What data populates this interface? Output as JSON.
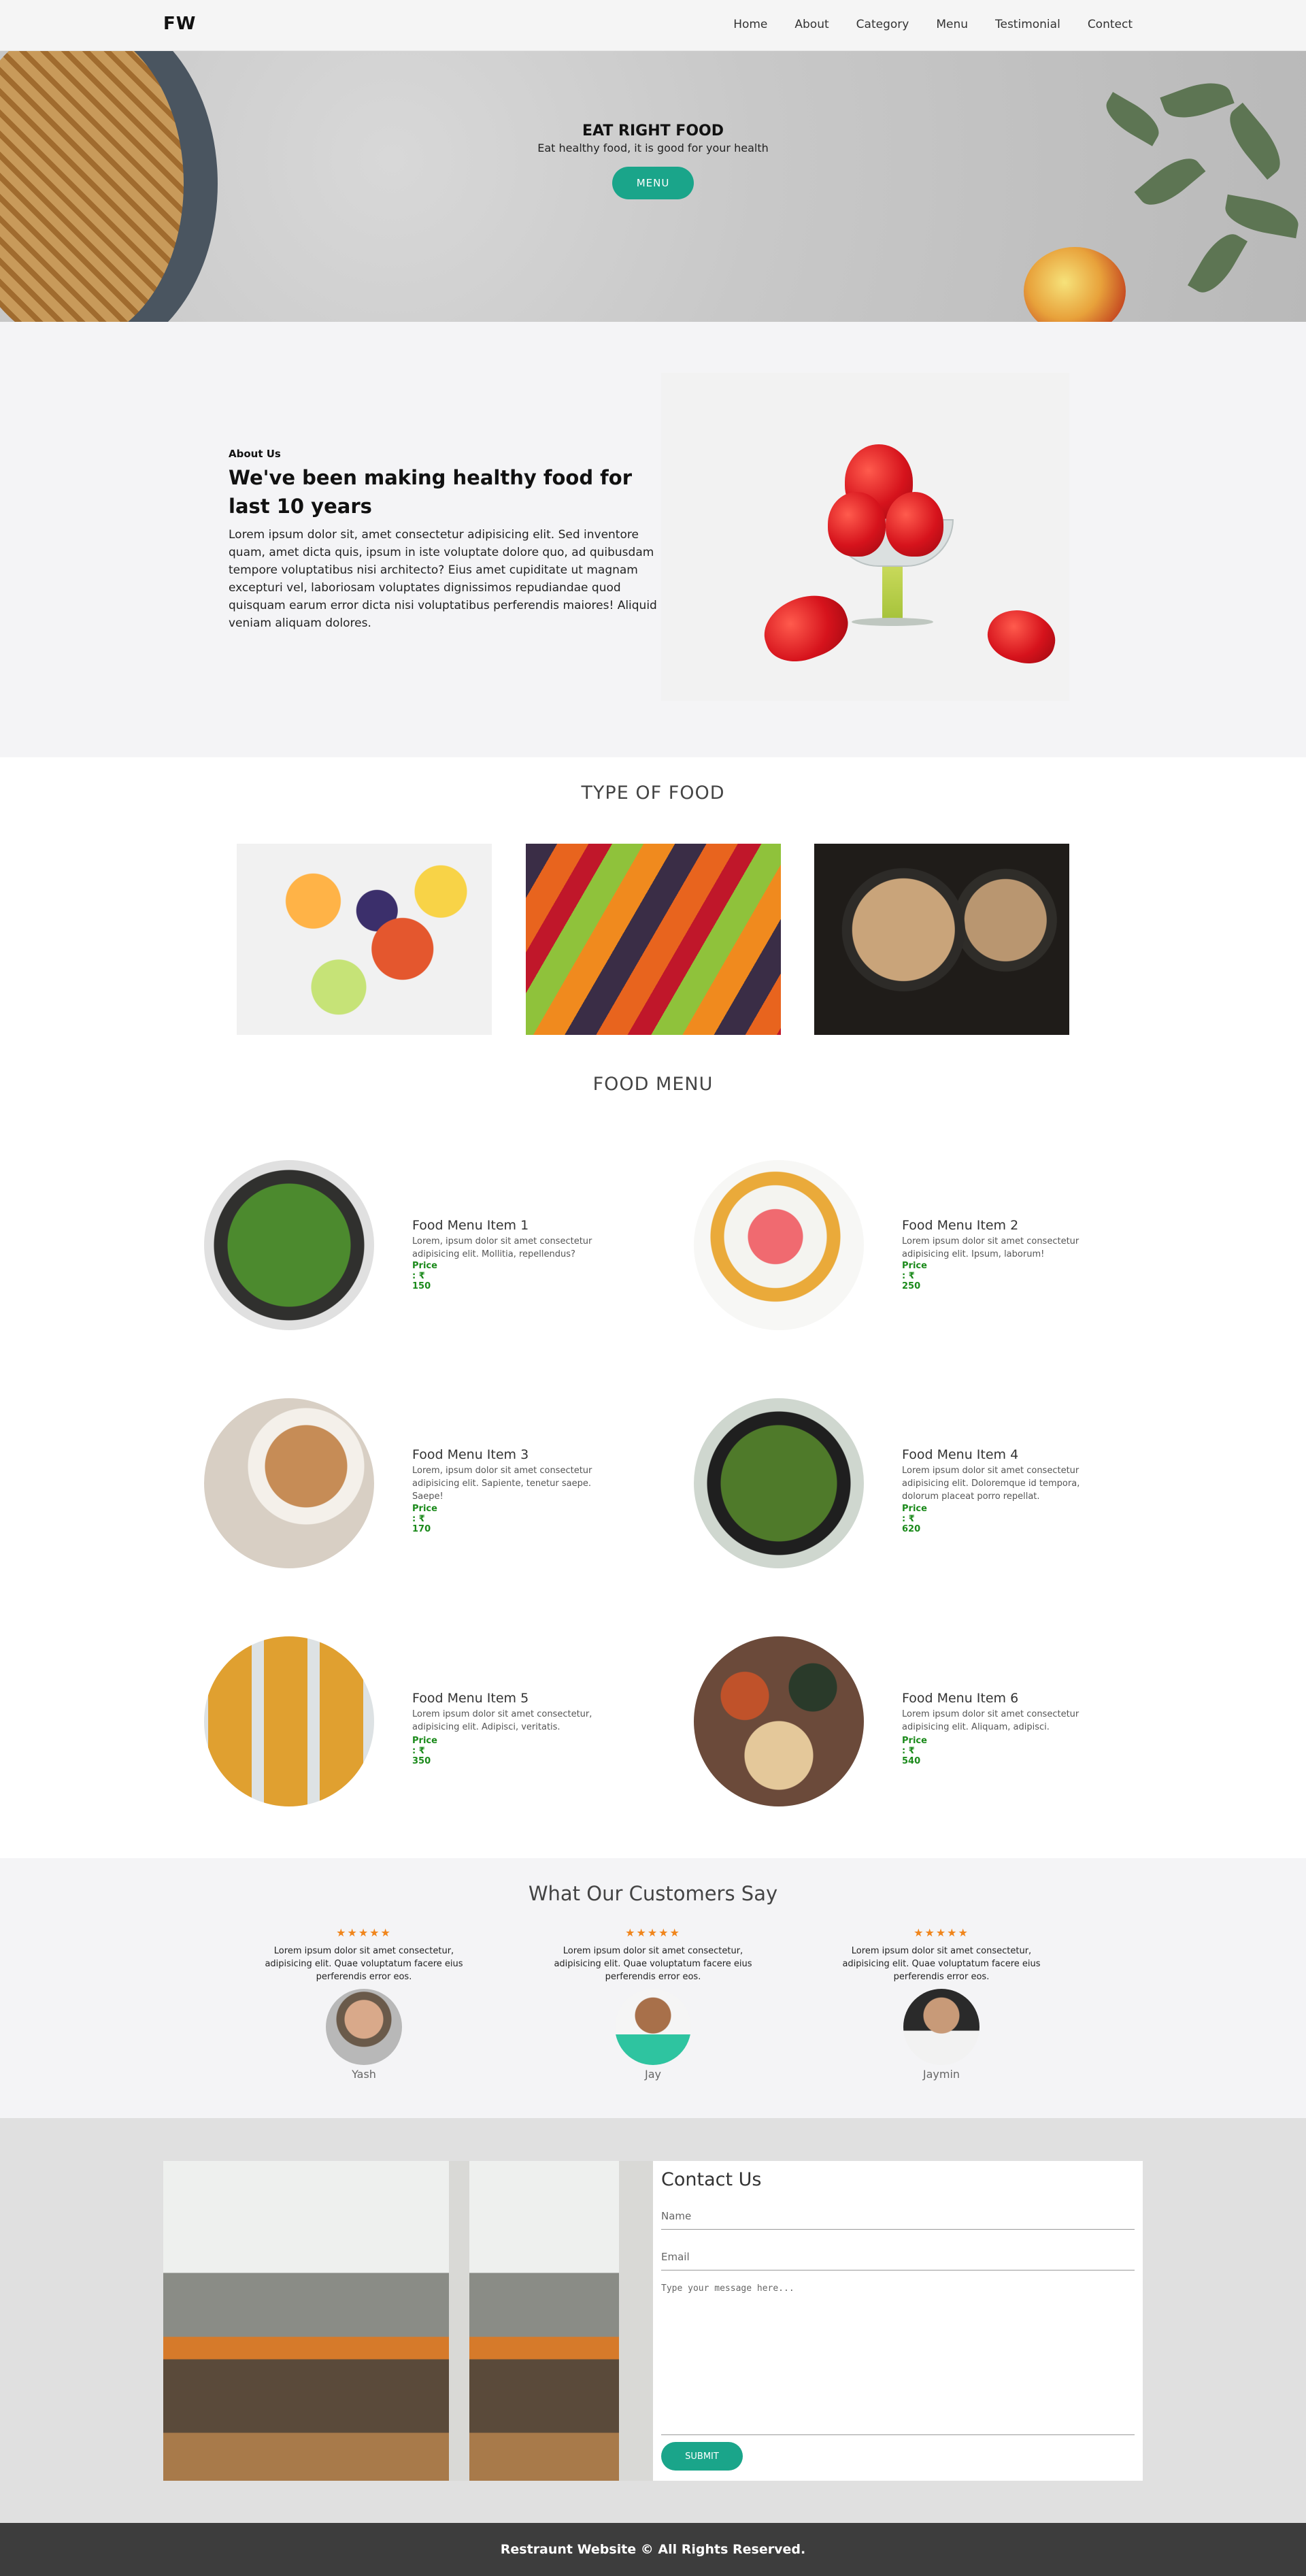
{
  "nav": {
    "logo": "FW",
    "links": [
      "Home",
      "About",
      "Category",
      "Menu",
      "Testimonial",
      "Contect"
    ]
  },
  "hero": {
    "title": "EAT RIGHT FOOD",
    "subtitle": "Eat healthy food, it is good for your health",
    "button": "MENU"
  },
  "about": {
    "kicker": "About Us",
    "title": "We've been making healthy food for last 10 years",
    "text": "Lorem ipsum dolor sit, amet consectetur adipisicing elit. Sed inventore quam, amet dicta quis, ipsum in iste voluptate dolore quo, ad quibusdam tempore voluptatibus nisi architecto? Eius amet cupiditate ut magnam excepturi vel, laboriosam voluptates dignissimos repudiandae quod quisquam earum error dicta nisi voluptatibus perferendis maiores! Aliquid veniam aliquam dolores."
  },
  "types": {
    "title": "TYPE OF FOOD"
  },
  "menu": {
    "title": "FOOD MENU",
    "items": [
      {
        "name": "Food Menu Item 1",
        "desc": "Lorem, ipsum dolor sit amet consectetur adipisicing elit. Mollitia, repellendus?",
        "price": "Price : ₹ 150"
      },
      {
        "name": "Food Menu Item 2",
        "desc": "Lorem ipsum dolor sit amet consectetur adipisicing elit. Ipsum, laborum!",
        "price": "Price : ₹ 250"
      },
      {
        "name": "Food Menu Item 3",
        "desc": "Lorem, ipsum dolor sit amet consectetur adipisicing elit. Sapiente, tenetur saepe. Saepe!",
        "price": "Price : ₹ 170"
      },
      {
        "name": "Food Menu Item 4",
        "desc": "Lorem ipsum dolor sit amet consectetur adipisicing elit. Doloremque id tempora, dolorum placeat porro repellat.",
        "price": "Price : ₹ 620"
      },
      {
        "name": "Food Menu Item 5",
        "desc": "Lorem ipsum dolor sit amet consectetur, adipisicing elit. Adipisci, veritatis.",
        "price": "Price : ₹ 350"
      },
      {
        "name": "Food Menu Item 6",
        "desc": "Lorem ipsum dolor sit amet consectetur adipisicing elit. Aliquam, adipisci.",
        "price": "Price : ₹ 540"
      }
    ]
  },
  "testimonials": {
    "title": "What Our Customers Say",
    "stars": "★★★★★",
    "items": [
      {
        "text": "Lorem ipsum dolor sit amet consectetur, adipisicing elit. Quae voluptatum facere eius perferendis error eos.",
        "name": "Yash"
      },
      {
        "text": "Lorem ipsum dolor sit amet consectetur, adipisicing elit. Quae voluptatum facere eius perferendis error eos.",
        "name": "Jay"
      },
      {
        "text": "Lorem ipsum dolor sit amet consectetur, adipisicing elit. Quae voluptatum facere eius perferendis error eos.",
        "name": "Jaymin"
      }
    ]
  },
  "contact": {
    "title": "Contact Us",
    "name_placeholder": "Name",
    "email_placeholder": "Email",
    "message_placeholder": "Type your message here...",
    "submit": "SUBMIT"
  },
  "footer": {
    "text": "Restraunt Website © All Rights Reserved."
  },
  "colors": {
    "accent": "#1aa58a",
    "price": "#1b8a1b",
    "stars": "#f0851c",
    "footer": "#3d3d3d"
  }
}
